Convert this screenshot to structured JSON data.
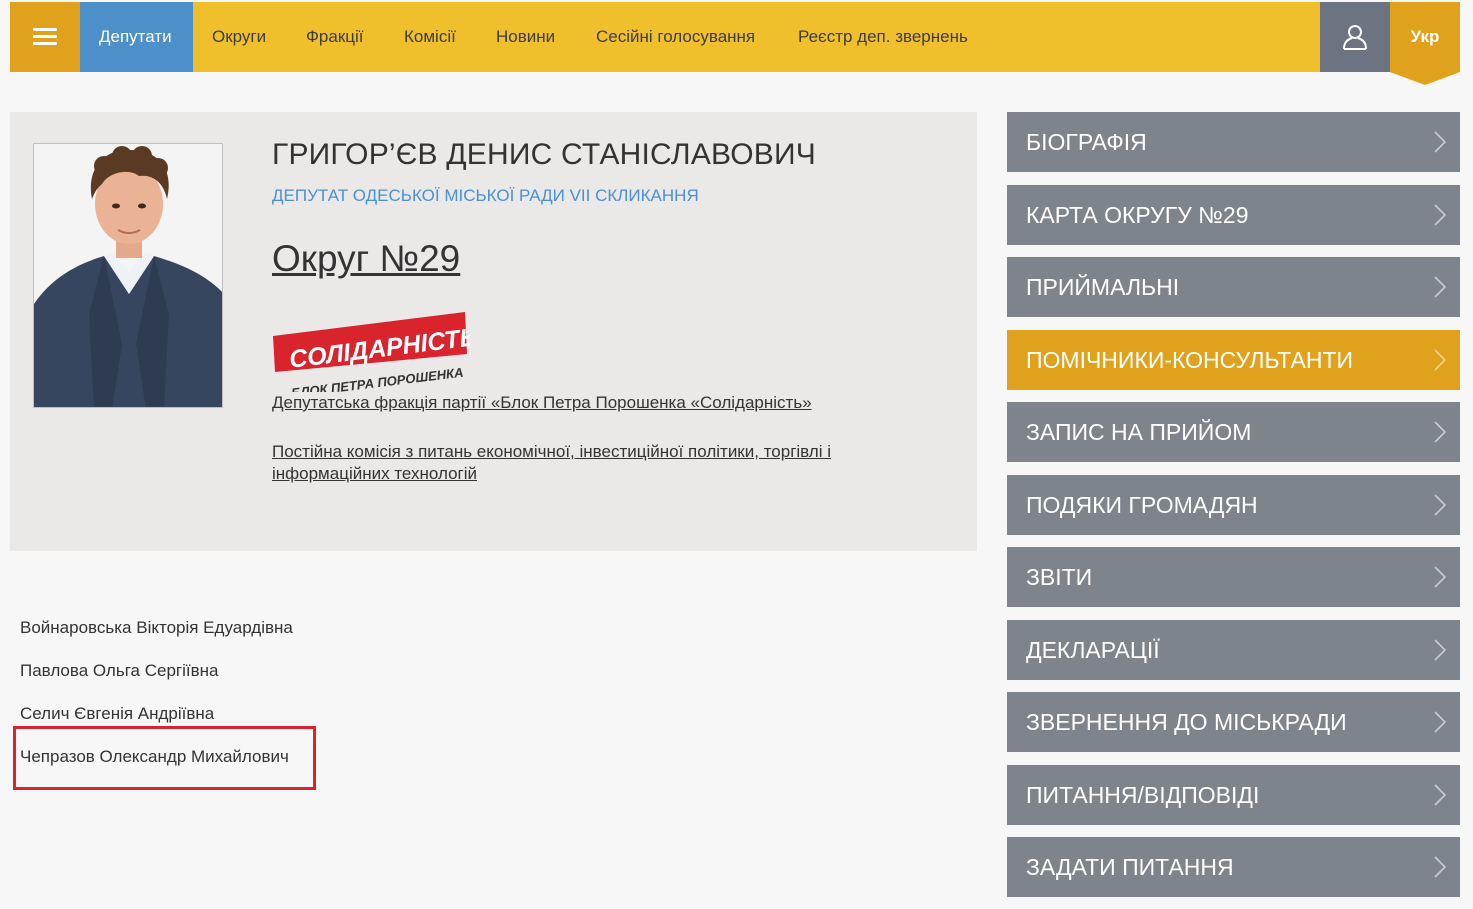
{
  "nav": {
    "items": [
      {
        "label": "Депутати",
        "active": true
      },
      {
        "label": "Округи",
        "active": false
      },
      {
        "label": "Фракції",
        "active": false
      },
      {
        "label": "Комісії",
        "active": false
      },
      {
        "label": "Новини",
        "active": false
      },
      {
        "label": "Сесійні голосування",
        "active": false
      },
      {
        "label": "Реєстр деп. звернень",
        "active": false
      }
    ],
    "user_icon": "user-icon",
    "lang": "Укр"
  },
  "profile": {
    "name": "ГРИГОР’ЄВ ДЕНИС СТАНІСЛАВОВИЧ",
    "subtitle": "ДЕПУТАТ ОДЕСЬКОЇ МІСЬКОЇ РАДИ VII СКЛИКАННЯ",
    "district": "Округ №29",
    "party_logo": {
      "top": "СОЛІДАРНІСТЬ",
      "bottom": "БЛОК ПЕТРА ПОРОШЕНКА"
    },
    "faction": "Депутатська фракція партії «Блок Петра Порошенка «Солідарність»",
    "commission": "Постійна комісія з питань економічної, інвестиційної політики, торгівлі і інформаційних технологій"
  },
  "assistants": [
    "Войнаровська Вікторія Едуардівна",
    "Павлова Ольга Сергіївна",
    "Селич Євгенія Андріївна",
    "Чепразов Олександр Михайлович"
  ],
  "side_menu": [
    {
      "label": "БІОГРАФІЯ",
      "active": false
    },
    {
      "label": "КАРТА ОКРУГУ №29",
      "active": false
    },
    {
      "label": "ПРИЙМАЛЬНІ",
      "active": false
    },
    {
      "label": "ПОМІЧНИКИ-КОНСУЛЬТАНТИ",
      "active": true
    },
    {
      "label": "ЗАПИС НА ПРИЙОМ",
      "active": false
    },
    {
      "label": "ПОДЯКИ ГРОМАДЯН",
      "active": false
    },
    {
      "label": "ЗВІТИ",
      "active": false
    },
    {
      "label": "ДЕКЛАРАЦІЇ",
      "active": false
    },
    {
      "label": "ЗВЕРНЕННЯ ДО МІСЬКРАДИ",
      "active": false
    },
    {
      "label": "ПИТАННЯ/ВІДПОВІДІ",
      "active": false
    },
    {
      "label": "ЗАДАТИ ПИТАННЯ",
      "active": false
    }
  ],
  "colors": {
    "nav_bg": "#f0bf2c",
    "accent": "#e0a21c",
    "active_nav": "#4d8fc9",
    "side_item": "#7e848b",
    "highlight": "#d9232d",
    "party_red": "#d9232d"
  }
}
